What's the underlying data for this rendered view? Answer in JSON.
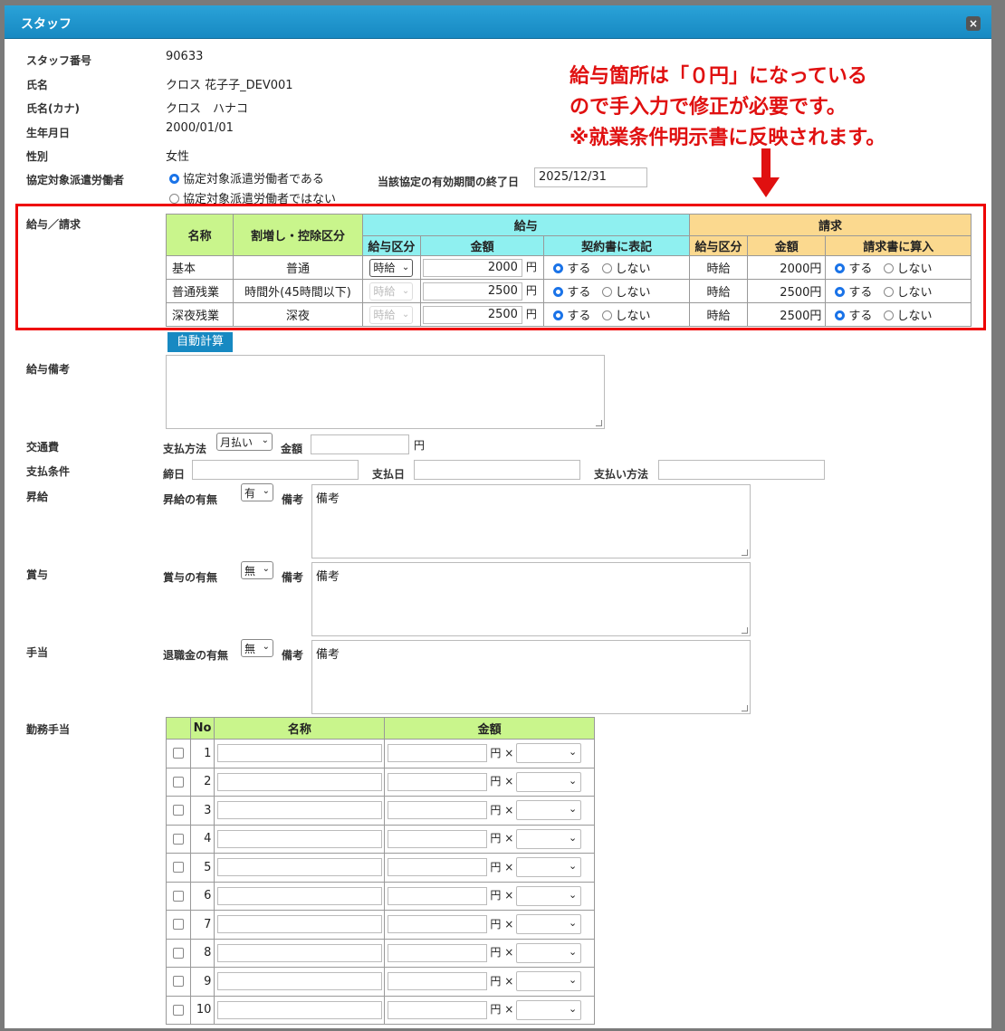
{
  "window": {
    "title": "スタッフ",
    "close_label": "×"
  },
  "staff": {
    "number_label": "スタッフ番号",
    "number": "90633",
    "name_label": "氏名",
    "name": "クロス 花子子_DEV001",
    "kana_label": "氏名(カナ)",
    "kana": "クロス　ハナコ",
    "birth_label": "生年月日",
    "birth": "2000/01/01",
    "gender_label": "性別",
    "gender": "女性",
    "dispatch_label": "協定対象派遣労働者",
    "dispatch_yes": "協定対象派遣労働者である",
    "dispatch_no": "協定対象派遣労働者ではない",
    "expiry_label": "当該協定の有効期間の終了日",
    "expiry_value": "2025/12/31"
  },
  "annotation": {
    "line1": "給与箇所は「０円」になっている",
    "line2": "ので手入力で修正が必要です。",
    "line3": "※就業条件明示書に反映されます。"
  },
  "salary": {
    "section_label": "給与／請求",
    "headers": {
      "name": "名称",
      "category": "割増し・控除区分",
      "salary": "給与",
      "billing": "請求",
      "pay_type": "給与区分",
      "amount": "金額",
      "contract": "契約書に表記",
      "bill_type": "給与区分",
      "bill_amount": "金額",
      "bill_include": "請求書に算入"
    },
    "radio_yes": "する",
    "radio_no": "しない",
    "yen": "円",
    "rows": [
      {
        "name": "基本",
        "category": "普通",
        "pay_type": "時給",
        "amount": "2000",
        "bill_type": "時給",
        "bill_amount": "2000円"
      },
      {
        "name": "普通残業",
        "category": "時間外(45時間以下)",
        "pay_type": "時給",
        "amount": "2500",
        "bill_type": "時給",
        "bill_amount": "2500円"
      },
      {
        "name": "深夜残業",
        "category": "深夜",
        "pay_type": "時給",
        "amount": "2500",
        "bill_type": "時給",
        "bill_amount": "2500円"
      }
    ],
    "auto_calc": "自動計算"
  },
  "salary_note": {
    "label": "給与備考",
    "value": ""
  },
  "transport": {
    "label": "交通費",
    "method_label": "支払方法",
    "method_value": "月払い",
    "amount_label": "金額",
    "amount_value": "",
    "yen": "円"
  },
  "payment": {
    "label": "支払条件",
    "closing_label": "締日",
    "pay_day_label": "支払日",
    "pay_method_label": "支払い方法"
  },
  "raise": {
    "label": "昇給",
    "sub_label": "昇給の有無",
    "value": "有",
    "note_label": "備考",
    "note_value": "備考"
  },
  "bonus": {
    "label": "賞与",
    "sub_label": "賞与の有無",
    "value": "無",
    "note_label": "備考",
    "note_value": "備考"
  },
  "allowance": {
    "label": "手当",
    "sub_label": "退職金の有無",
    "value": "無",
    "note_label": "備考",
    "note_value": "備考"
  },
  "work_allowance": {
    "label": "勤務手当",
    "headers": {
      "no": "No",
      "name": "名称",
      "amount": "金額"
    },
    "suffix": "円 ×",
    "rows": [
      "1",
      "2",
      "3",
      "4",
      "5",
      "6",
      "7",
      "8",
      "9",
      "10"
    ]
  },
  "colors": {
    "title_bar": "#1789c2",
    "annotation": "#e01010",
    "green_header": "#c9f58c",
    "cyan_header": "#8ff0f0",
    "orange_header": "#fbd98f"
  }
}
